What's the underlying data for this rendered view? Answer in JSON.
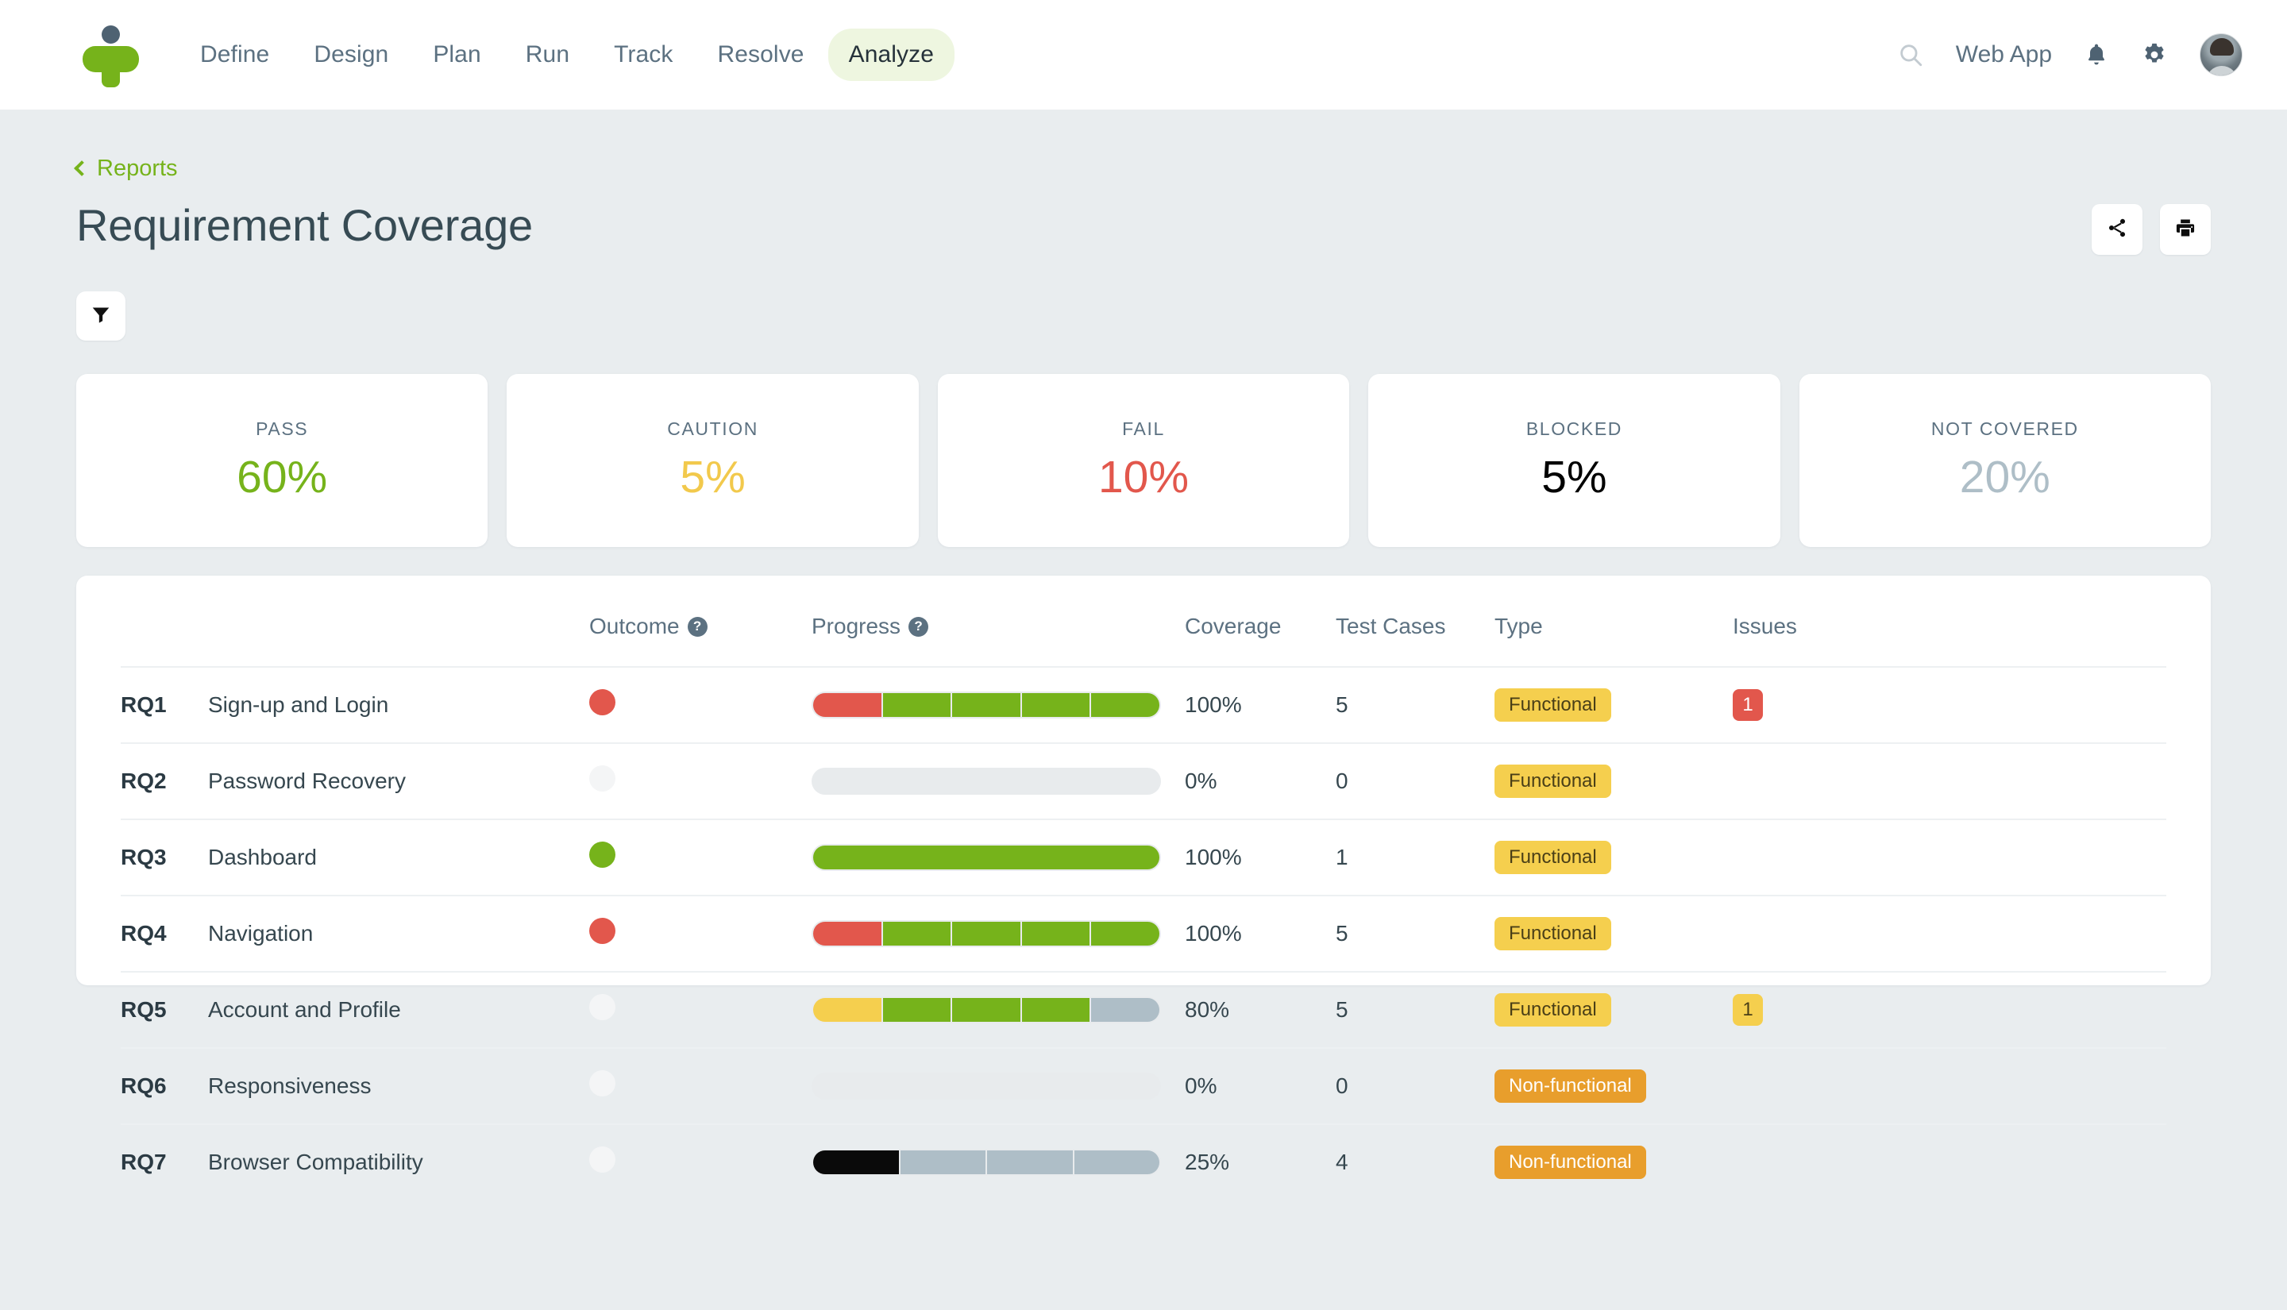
{
  "nav": {
    "logo_name": "tricentis-logo",
    "items": [
      {
        "label": "Define",
        "active": false
      },
      {
        "label": "Design",
        "active": false
      },
      {
        "label": "Plan",
        "active": false
      },
      {
        "label": "Run",
        "active": false
      },
      {
        "label": "Track",
        "active": false
      },
      {
        "label": "Resolve",
        "active": false
      },
      {
        "label": "Analyze",
        "active": true
      }
    ],
    "search_icon": "search-icon",
    "webapp_label": "Web App",
    "bell_icon": "bell-icon",
    "gear_icon": "gear-icon",
    "avatar_name": "user-avatar"
  },
  "header": {
    "breadcrumb_label": "Reports",
    "title": "Requirement Coverage",
    "share_icon": "share-icon",
    "print_icon": "print-icon",
    "filter_icon": "filter-icon"
  },
  "stats": [
    {
      "label": "PASS",
      "value": "60%",
      "color": "#76b31b"
    },
    {
      "label": "CAUTION",
      "value": "5%",
      "color": "#f2c94c"
    },
    {
      "label": "FAIL",
      "value": "10%",
      "color": "#e2574c"
    },
    {
      "label": "BLOCKED",
      "value": "5%",
      "color": "#000000"
    },
    {
      "label": "NOT COVERED",
      "value": "20%",
      "color": "#aebec7"
    }
  ],
  "table": {
    "columns": [
      {
        "label": "",
        "help": false
      },
      {
        "label": "",
        "help": false
      },
      {
        "label": "Outcome",
        "help": true
      },
      {
        "label": "Progress",
        "help": true
      },
      {
        "label": "Coverage",
        "help": false
      },
      {
        "label": "Test Cases",
        "help": false
      },
      {
        "label": "Type",
        "help": false
      },
      {
        "label": "Issues",
        "help": false
      }
    ],
    "rows": [
      {
        "id": "RQ1",
        "name": "Sign-up and Login",
        "outcome": "fail",
        "outcome_color": "#e2574c",
        "progress": [
          {
            "status": "fail",
            "color": "#e2574c",
            "weight": 1
          },
          {
            "status": "pass",
            "color": "#76b31b",
            "weight": 1
          },
          {
            "status": "pass",
            "color": "#76b31b",
            "weight": 1
          },
          {
            "status": "pass",
            "color": "#76b31b",
            "weight": 1
          },
          {
            "status": "pass",
            "color": "#76b31b",
            "weight": 1
          }
        ],
        "coverage": "100%",
        "test_cases": "5",
        "type": "Functional",
        "type_bg": "#f5cf4e",
        "type_fg": "#4a3f17",
        "issues": "1",
        "issues_bg": "#e2574c"
      },
      {
        "id": "RQ2",
        "name": "Password Recovery",
        "outcome": "none",
        "outcome_color": "#f4f5f6",
        "progress": [],
        "coverage": "0%",
        "test_cases": "0",
        "type": "Functional",
        "type_bg": "#f5cf4e",
        "type_fg": "#4a3f17",
        "issues": "",
        "issues_bg": ""
      },
      {
        "id": "RQ3",
        "name": "Dashboard",
        "outcome": "pass",
        "outcome_color": "#76b31b",
        "progress": [
          {
            "status": "pass",
            "color": "#76b31b",
            "weight": 1
          }
        ],
        "coverage": "100%",
        "test_cases": "1",
        "type": "Functional",
        "type_bg": "#f5cf4e",
        "type_fg": "#4a3f17",
        "issues": "",
        "issues_bg": ""
      },
      {
        "id": "RQ4",
        "name": "Navigation",
        "outcome": "fail",
        "outcome_color": "#e2574c",
        "progress": [
          {
            "status": "fail",
            "color": "#e2574c",
            "weight": 1
          },
          {
            "status": "pass",
            "color": "#76b31b",
            "weight": 1
          },
          {
            "status": "pass",
            "color": "#76b31b",
            "weight": 1
          },
          {
            "status": "pass",
            "color": "#76b31b",
            "weight": 1
          },
          {
            "status": "pass",
            "color": "#76b31b",
            "weight": 1
          }
        ],
        "coverage": "100%",
        "test_cases": "5",
        "type": "Functional",
        "type_bg": "#f5cf4e",
        "type_fg": "#4a3f17",
        "issues": "",
        "issues_bg": ""
      },
      {
        "id": "RQ5",
        "name": "Account and Profile",
        "outcome": "none",
        "outcome_color": "#f4f5f6",
        "progress": [
          {
            "status": "caution",
            "color": "#f5cf4e",
            "weight": 1
          },
          {
            "status": "pass",
            "color": "#76b31b",
            "weight": 1
          },
          {
            "status": "pass",
            "color": "#76b31b",
            "weight": 1
          },
          {
            "status": "pass",
            "color": "#76b31b",
            "weight": 1
          },
          {
            "status": "not-covered",
            "color": "#aebec7",
            "weight": 1
          }
        ],
        "coverage": "80%",
        "test_cases": "5",
        "type": "Functional",
        "type_bg": "#f5cf4e",
        "type_fg": "#4a3f17",
        "issues": "1",
        "issues_bg": "#f5cf4e"
      },
      {
        "id": "RQ6",
        "name": "Responsiveness",
        "outcome": "none",
        "outcome_color": "#f4f5f6",
        "progress": [],
        "coverage": "0%",
        "test_cases": "0",
        "type": "Non-functional",
        "type_bg": "#e89e2c",
        "type_fg": "#ffffff",
        "issues": "",
        "issues_bg": ""
      },
      {
        "id": "RQ7",
        "name": "Browser Compatibility",
        "outcome": "none",
        "outcome_color": "#f4f5f6",
        "progress": [
          {
            "status": "blocked",
            "color": "#0a0a0a",
            "weight": 1
          },
          {
            "status": "not-covered",
            "color": "#aebec7",
            "weight": 1
          },
          {
            "status": "not-covered",
            "color": "#aebec7",
            "weight": 1
          },
          {
            "status": "not-covered",
            "color": "#aebec7",
            "weight": 1
          }
        ],
        "coverage": "25%",
        "test_cases": "4",
        "type": "Non-functional",
        "type_bg": "#e89e2c",
        "type_fg": "#ffffff",
        "issues": "",
        "issues_bg": ""
      }
    ]
  }
}
